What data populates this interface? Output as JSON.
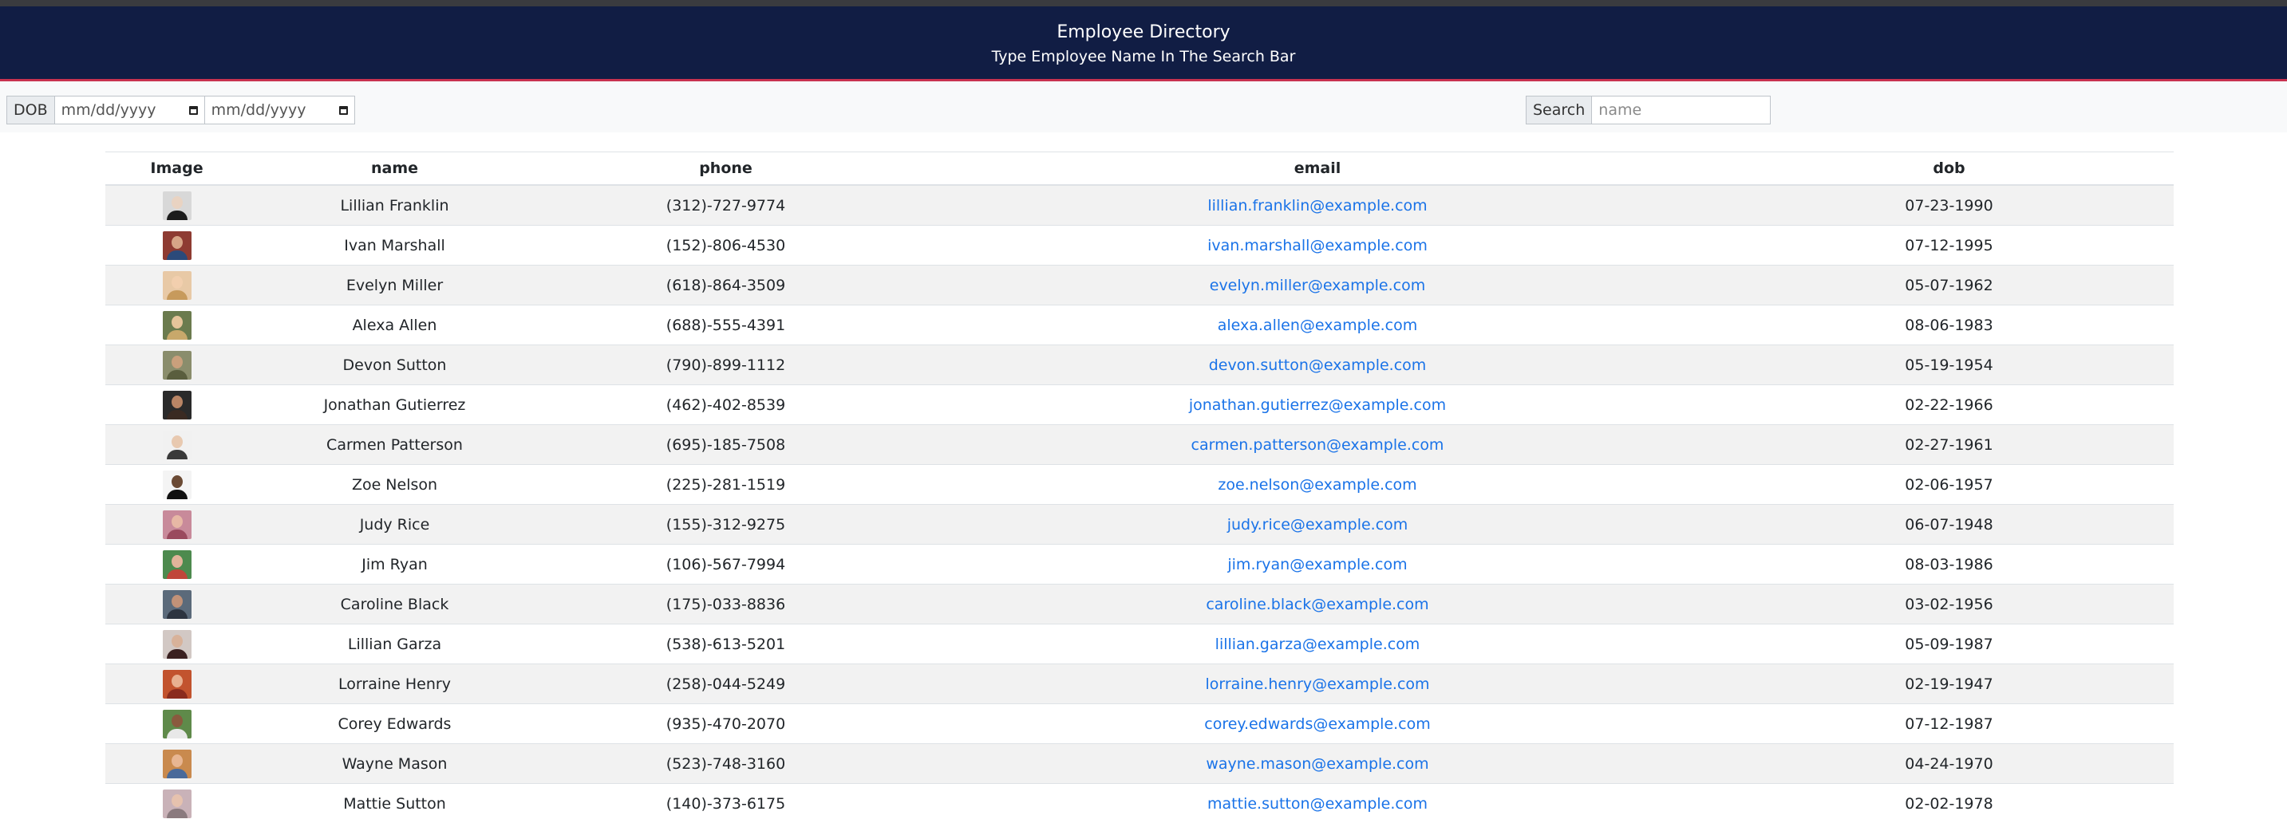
{
  "header": {
    "title": "Employee Directory",
    "subtitle": "Type Employee Name In The Search Bar"
  },
  "filters": {
    "dob_label": "DOB",
    "date_from_placeholder": "mm/dd/yyyy",
    "date_to_placeholder": "mm/dd/yyyy",
    "search_label": "Search",
    "search_placeholder": "name"
  },
  "table": {
    "columns": [
      "Image",
      "name",
      "phone",
      "email",
      "dob"
    ],
    "rows": [
      {
        "name": "Lillian Franklin",
        "phone": "(312)-727-9774",
        "email": "lillian.franklin@example.com",
        "dob": "07-23-1990",
        "avatar_bg": "#d8d8d8",
        "avatar_skin": "#e9d3c2",
        "avatar_shirt": "#1c1c1c"
      },
      {
        "name": "Ivan Marshall",
        "phone": "(152)-806-4530",
        "email": "ivan.marshall@example.com",
        "dob": "07-12-1995",
        "avatar_bg": "#8e3b32",
        "avatar_skin": "#d7a587",
        "avatar_shirt": "#2b4a7a"
      },
      {
        "name": "Evelyn Miller",
        "phone": "(618)-864-3509",
        "email": "evelyn.miller@example.com",
        "dob": "05-07-1962",
        "avatar_bg": "#e8c9a6",
        "avatar_skin": "#f2cfae",
        "avatar_shirt": "#c79a5c"
      },
      {
        "name": "Alexa Allen",
        "phone": "(688)-555-4391",
        "email": "alexa.allen@example.com",
        "dob": "08-06-1983",
        "avatar_bg": "#6b7b4e",
        "avatar_skin": "#e6c49a",
        "avatar_shirt": "#c8a86b"
      },
      {
        "name": "Devon Sutton",
        "phone": "(790)-899-1112",
        "email": "devon.sutton@example.com",
        "dob": "05-19-1954",
        "avatar_bg": "#8a8d6c",
        "avatar_skin": "#caa07c",
        "avatar_shirt": "#5a5e3e"
      },
      {
        "name": "Jonathan Gutierrez",
        "phone": "(462)-402-8539",
        "email": "jonathan.gutierrez@example.com",
        "dob": "02-22-1966",
        "avatar_bg": "#2a2a2a",
        "avatar_skin": "#b98565",
        "avatar_shirt": "#3a2a22"
      },
      {
        "name": "Carmen Patterson",
        "phone": "(695)-185-7508",
        "email": "carmen.patterson@example.com",
        "dob": "02-27-1961",
        "avatar_bg": "#f1f1f1",
        "avatar_skin": "#e8c9b0",
        "avatar_shirt": "#3a3a3a"
      },
      {
        "name": "Zoe Nelson",
        "phone": "(225)-281-1519",
        "email": "zoe.nelson@example.com",
        "dob": "02-06-1957",
        "avatar_bg": "#f4f4f4",
        "avatar_skin": "#6b4a34",
        "avatar_shirt": "#111111"
      },
      {
        "name": "Judy Rice",
        "phone": "(155)-312-9275",
        "email": "judy.rice@example.com",
        "dob": "06-07-1948",
        "avatar_bg": "#c88a9a",
        "avatar_skin": "#e7b8a5",
        "avatar_shirt": "#9a4a5e"
      },
      {
        "name": "Jim Ryan",
        "phone": "(106)-567-7994",
        "email": "jim.ryan@example.com",
        "dob": "08-03-1986",
        "avatar_bg": "#4d8a4e",
        "avatar_skin": "#e2b49a",
        "avatar_shirt": "#c0463a"
      },
      {
        "name": "Caroline Black",
        "phone": "(175)-033-8836",
        "email": "caroline.black@example.com",
        "dob": "03-02-1956",
        "avatar_bg": "#5b6a7a",
        "avatar_skin": "#c29278",
        "avatar_shirt": "#2d3440"
      },
      {
        "name": "Lillian Garza",
        "phone": "(538)-613-5201",
        "email": "lillian.garza@example.com",
        "dob": "05-09-1987",
        "avatar_bg": "#d2c8c4",
        "avatar_skin": "#d8b29a",
        "avatar_shirt": "#3a2020"
      },
      {
        "name": "Lorraine Henry",
        "phone": "(258)-044-5249",
        "email": "lorraine.henry@example.com",
        "dob": "02-19-1947",
        "avatar_bg": "#c2532e",
        "avatar_skin": "#e8b090",
        "avatar_shirt": "#8a2c1e"
      },
      {
        "name": "Corey Edwards",
        "phone": "(935)-470-2070",
        "email": "corey.edwards@example.com",
        "dob": "07-12-1987",
        "avatar_bg": "#5f8a4a",
        "avatar_skin": "#8a5a3e",
        "avatar_shirt": "#e8e8e8"
      },
      {
        "name": "Wayne Mason",
        "phone": "(523)-748-3160",
        "email": "wayne.mason@example.com",
        "dob": "04-24-1970",
        "avatar_bg": "#c98a4e",
        "avatar_skin": "#e8b692",
        "avatar_shirt": "#4a6a9a"
      },
      {
        "name": "Mattie Sutton",
        "phone": "(140)-373-6175",
        "email": "mattie.sutton@example.com",
        "dob": "02-02-1978",
        "avatar_bg": "#c9b2b8",
        "avatar_skin": "#e6c2ae",
        "avatar_shirt": "#8a7a7e"
      }
    ]
  }
}
